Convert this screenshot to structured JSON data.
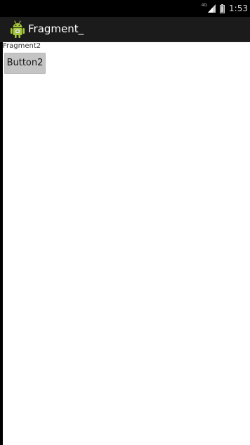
{
  "status_bar": {
    "network_type": "4G",
    "time": "1:53",
    "signal_icon": "signal-bars-icon",
    "battery_icon": "battery-icon"
  },
  "action_bar": {
    "app_icon": "android-robot-icon",
    "title": "Fragment_"
  },
  "fragment": {
    "label": "Fragment2",
    "button_label": "Button2"
  },
  "colors": {
    "status_bar_bg": "#000000",
    "action_bar_bg": "#1b1b1b",
    "content_bg": "#ffffff",
    "button_bg": "#c4c4c4",
    "android_green": "#a4c639"
  }
}
